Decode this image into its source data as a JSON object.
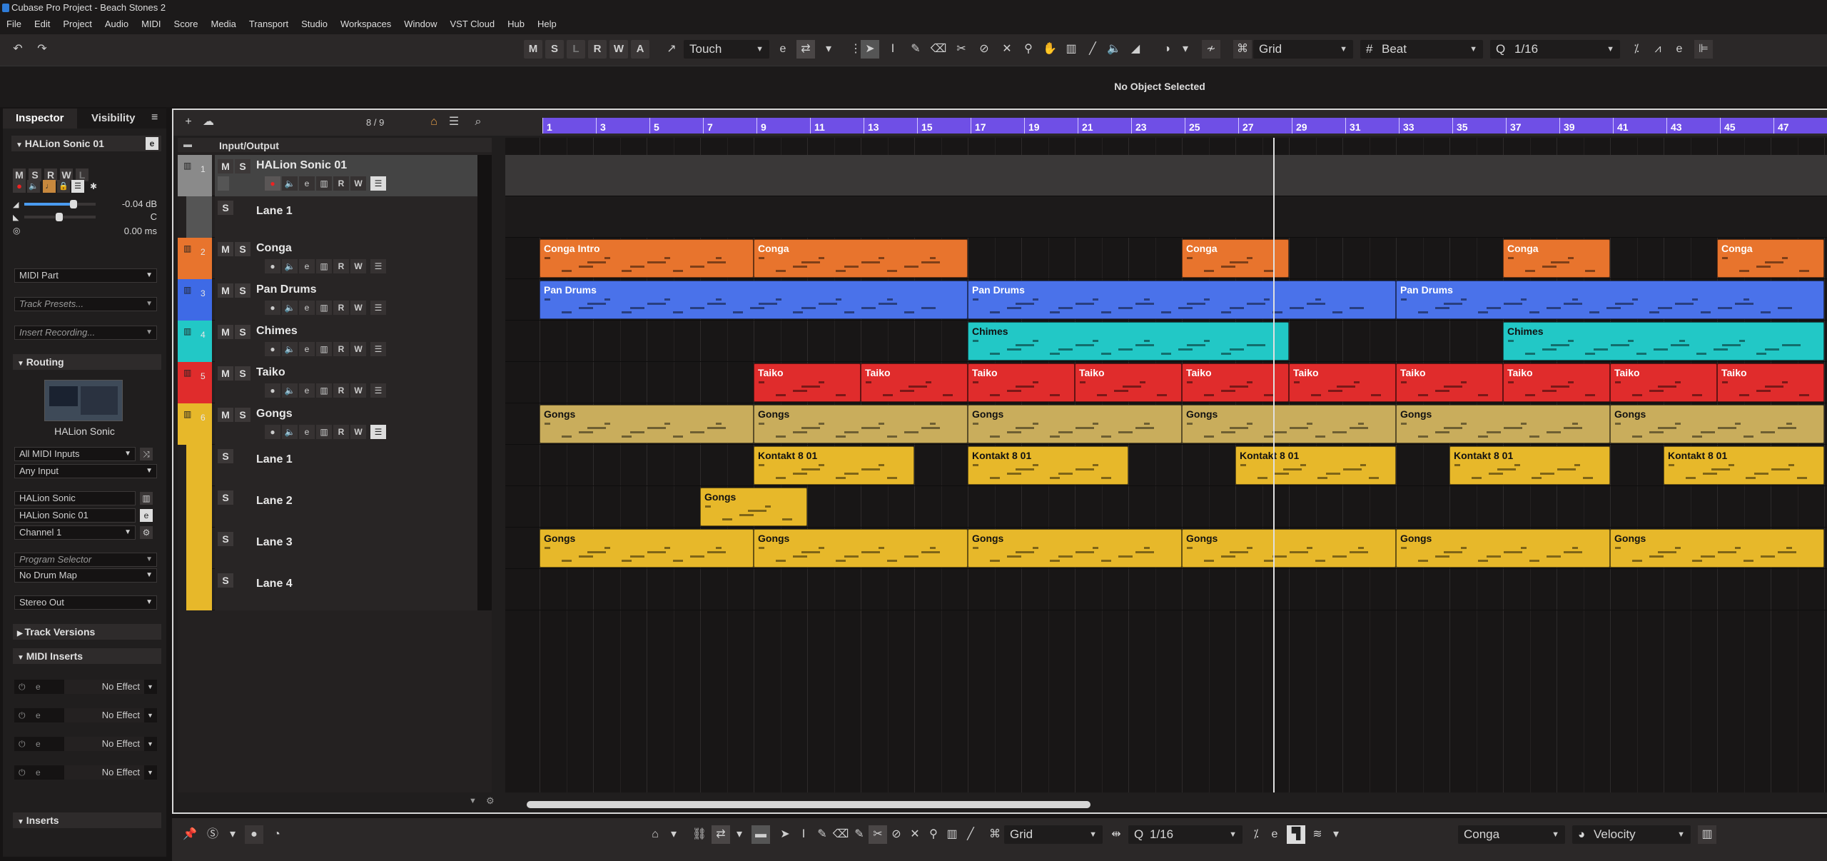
{
  "window": {
    "title": "Cubase Pro Project - Beach Stones 2"
  },
  "menu": [
    "File",
    "Edit",
    "Project",
    "Audio",
    "MIDI",
    "Score",
    "Media",
    "Transport",
    "Studio",
    "Workspaces",
    "Window",
    "VST Cloud",
    "Hub",
    "Help"
  ],
  "toolbar": {
    "state_buttons": [
      "M",
      "S",
      "L",
      "R",
      "W",
      "A"
    ],
    "automation_mode": "Touch",
    "snap_type": "Grid",
    "grid_type": "Beat",
    "quantize": "1/16"
  },
  "info_line": {
    "message": "No Object Selected"
  },
  "inspector": {
    "tabs": [
      "Inspector",
      "Visibility"
    ],
    "track_name": "HALion Sonic 01",
    "buttons": [
      "M",
      "S",
      "R",
      "W",
      "L"
    ],
    "volume": "-0.04 dB",
    "pan": "C",
    "delay": "0.00 ms",
    "part_type": "MIDI Part",
    "track_presets": "Track Presets...",
    "insert_recording": "Insert Recording...",
    "routing_label": "Routing",
    "instrument_name": "HALion Sonic",
    "input": "All MIDI Inputs",
    "input_sub": "Any Input",
    "output_instrument": "HALion Sonic",
    "output": "HALion Sonic 01",
    "channel": "Channel 1",
    "program_selector": "Program Selector",
    "drum_map": "No Drum Map",
    "stereo_out": "Stereo Out",
    "track_versions": "Track Versions",
    "midi_inserts": "MIDI Inserts",
    "effect_slots": [
      "No Effect",
      "No Effect",
      "No Effect",
      "No Effect"
    ],
    "inserts": "Inserts"
  },
  "project": {
    "track_count": "8 / 9",
    "folder_label": "Input/Output",
    "tracks": [
      {
        "num": "1",
        "name": "HALion Sonic 01",
        "color": "#8a8a8a",
        "type": "instrument",
        "selected": true
      },
      {
        "num": "",
        "name": "Lane 1",
        "color": "#8a8a8a",
        "type": "lane"
      },
      {
        "num": "2",
        "name": "Conga",
        "color": "#e8742d",
        "type": "instrument"
      },
      {
        "num": "3",
        "name": "Pan Drums",
        "color": "#3e6ae6",
        "type": "instrument"
      },
      {
        "num": "4",
        "name": "Chimes",
        "color": "#22c8c6",
        "type": "instrument"
      },
      {
        "num": "5",
        "name": "Taiko",
        "color": "#e02c2c",
        "type": "instrument"
      },
      {
        "num": "6",
        "name": "Gongs",
        "color": "#e7b82a",
        "type": "instrument"
      },
      {
        "num": "",
        "name": "Lane 1",
        "color": "#e7b82a",
        "type": "lane"
      },
      {
        "num": "",
        "name": "Lane 2",
        "color": "#e7b82a",
        "type": "lane"
      },
      {
        "num": "",
        "name": "Lane 3",
        "color": "#e7b82a",
        "type": "lane"
      },
      {
        "num": "",
        "name": "Lane 4",
        "color": "#e7b82a",
        "type": "lane"
      }
    ],
    "ruler_bars": [
      "1",
      "3",
      "5",
      "7",
      "9",
      "11",
      "13",
      "15",
      "17",
      "19",
      "21",
      "23",
      "25",
      "27",
      "29",
      "31",
      "33",
      "35",
      "37",
      "39",
      "41",
      "43",
      "45",
      "47"
    ],
    "parts": [
      {
        "row": 2,
        "start": 1,
        "end": 9,
        "label": "Conga Intro",
        "color": "#e8742d"
      },
      {
        "row": 2,
        "start": 9,
        "end": 17,
        "label": "Conga",
        "color": "#e8742d"
      },
      {
        "row": 2,
        "start": 25,
        "end": 29,
        "label": "Conga",
        "color": "#e8742d"
      },
      {
        "row": 2,
        "start": 37,
        "end": 41,
        "label": "Conga",
        "color": "#e8742d"
      },
      {
        "row": 2,
        "start": 45,
        "end": 49,
        "label": "Conga",
        "color": "#e8742d"
      },
      {
        "row": 3,
        "start": 1,
        "end": 17,
        "label": "Pan Drums",
        "color": "#4a72ea"
      },
      {
        "row": 3,
        "start": 17,
        "end": 33,
        "label": "Pan Drums",
        "color": "#4a72ea"
      },
      {
        "row": 3,
        "start": 33,
        "end": 49,
        "label": "Pan Drums",
        "color": "#4a72ea"
      },
      {
        "row": 4,
        "start": 17,
        "end": 29,
        "label": "Chimes",
        "color": "#22c8c6"
      },
      {
        "row": 4,
        "start": 37,
        "end": 49,
        "label": "Chimes",
        "color": "#22c8c6"
      },
      {
        "row": 5,
        "start": 9,
        "end": 13,
        "label": "Taiko",
        "color": "#e02c2c"
      },
      {
        "row": 5,
        "start": 13,
        "end": 17,
        "label": "Taiko",
        "color": "#e02c2c"
      },
      {
        "row": 5,
        "start": 17,
        "end": 21,
        "label": "Taiko",
        "color": "#e02c2c"
      },
      {
        "row": 5,
        "start": 21,
        "end": 25,
        "label": "Taiko",
        "color": "#e02c2c"
      },
      {
        "row": 5,
        "start": 25,
        "end": 29,
        "label": "Taiko",
        "color": "#e02c2c"
      },
      {
        "row": 5,
        "start": 29,
        "end": 33,
        "label": "Taiko",
        "color": "#e02c2c"
      },
      {
        "row": 5,
        "start": 33,
        "end": 37,
        "label": "Taiko",
        "color": "#e02c2c"
      },
      {
        "row": 5,
        "start": 37,
        "end": 41,
        "label": "Taiko",
        "color": "#e02c2c"
      },
      {
        "row": 5,
        "start": 41,
        "end": 45,
        "label": "Taiko",
        "color": "#e02c2c"
      },
      {
        "row": 5,
        "start": 45,
        "end": 49,
        "label": "Taiko",
        "color": "#e02c2c"
      },
      {
        "row": 6,
        "start": 1,
        "end": 9,
        "label": "Gongs",
        "color": "#c9ad5c"
      },
      {
        "row": 6,
        "start": 9,
        "end": 17,
        "label": "Gongs",
        "color": "#c9ad5c"
      },
      {
        "row": 6,
        "start": 17,
        "end": 25,
        "label": "Gongs",
        "color": "#c9ad5c"
      },
      {
        "row": 6,
        "start": 25,
        "end": 33,
        "label": "Gongs",
        "color": "#c9ad5c"
      },
      {
        "row": 6,
        "start": 33,
        "end": 41,
        "label": "Gongs",
        "color": "#c9ad5c"
      },
      {
        "row": 6,
        "start": 41,
        "end": 49,
        "label": "Gongs",
        "color": "#c9ad5c"
      },
      {
        "row": 7,
        "start": 9,
        "end": 15,
        "label": "Kontakt 8 01",
        "color": "#e7b82a"
      },
      {
        "row": 7,
        "start": 17,
        "end": 23,
        "label": "Kontakt 8 01",
        "color": "#e7b82a"
      },
      {
        "row": 7,
        "start": 27,
        "end": 33,
        "label": "Kontakt 8 01",
        "color": "#e7b82a"
      },
      {
        "row": 7,
        "start": 35,
        "end": 41,
        "label": "Kontakt 8 01",
        "color": "#e7b82a"
      },
      {
        "row": 7,
        "start": 43,
        "end": 49,
        "label": "Kontakt 8 01",
        "color": "#e7b82a"
      },
      {
        "row": 8,
        "start": 7,
        "end": 11,
        "label": "Gongs",
        "color": "#e7b82a"
      },
      {
        "row": 9,
        "start": 1,
        "end": 9,
        "label": "Gongs",
        "color": "#e7b82a"
      },
      {
        "row": 9,
        "start": 9,
        "end": 17,
        "label": "Gongs",
        "color": "#e7b82a"
      },
      {
        "row": 9,
        "start": 17,
        "end": 25,
        "label": "Gongs",
        "color": "#e7b82a"
      },
      {
        "row": 9,
        "start": 25,
        "end": 33,
        "label": "Gongs",
        "color": "#e7b82a"
      },
      {
        "row": 9,
        "start": 33,
        "end": 41,
        "label": "Gongs",
        "color": "#e7b82a"
      },
      {
        "row": 9,
        "start": 41,
        "end": 49,
        "label": "Gongs",
        "color": "#e7b82a"
      }
    ]
  },
  "bottombar": {
    "snap_type": "Grid",
    "quantize": "1/16",
    "track_select": "Conga",
    "controller": "Velocity"
  }
}
